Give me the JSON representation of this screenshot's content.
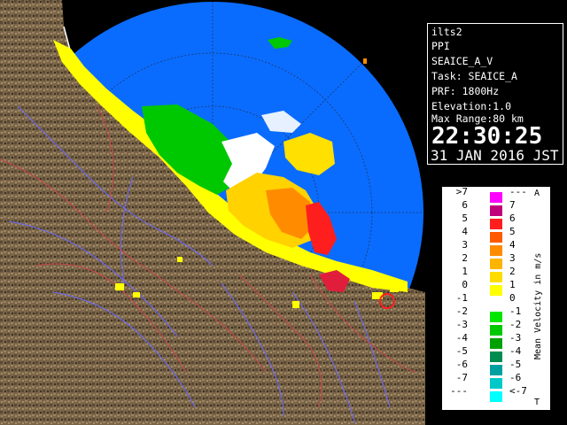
{
  "info": {
    "site": "ilts2",
    "scan": "PPI",
    "product": "SEAICE_A_V",
    "task": "Task: SEAICE_A",
    "prf": "PRF: 1800Hz",
    "elevation": "Elevation:1.0",
    "max_range": "Max Range:80 km",
    "time": "22:30:25",
    "date": "31 JAN 2016 JST"
  },
  "legend": {
    "title": "Mean Velocity in m/s",
    "top_marker": "A",
    "bottom_marker": "T",
    "rows": [
      {
        "left": ">7",
        "right": "---",
        "color": "#ff00ff"
      },
      {
        "left": "6",
        "right": "7",
        "color": "#c0007a"
      },
      {
        "left": "5",
        "right": "6",
        "color": "#ff1e1e"
      },
      {
        "left": "4",
        "right": "5",
        "color": "#ff5a00"
      },
      {
        "left": "3",
        "right": "4",
        "color": "#ff8c00"
      },
      {
        "left": "2",
        "right": "3",
        "color": "#ffb400"
      },
      {
        "left": "1",
        "right": "2",
        "color": "#ffdc00"
      },
      {
        "left": "0",
        "right": "1",
        "color": "#ffff00"
      },
      {
        "left": "-1",
        "right": "0",
        "color": "#ffffff"
      },
      {
        "left": "-2",
        "right": "-1",
        "color": "#00e600"
      },
      {
        "left": "-3",
        "right": "-2",
        "color": "#00c800"
      },
      {
        "left": "-4",
        "right": "-3",
        "color": "#00a000"
      },
      {
        "left": "-5",
        "right": "-4",
        "color": "#008c50"
      },
      {
        "left": "-6",
        "right": "-5",
        "color": "#00a0a0"
      },
      {
        "left": "-7",
        "right": "-6",
        "color": "#00c8c8"
      },
      {
        "left": "---",
        "right": "<-7",
        "color": "#00ffff"
      }
    ]
  },
  "colors": {
    "radar_fill": "#0a6cff",
    "land": "#7a6548",
    "land_shadow": "#3b3024",
    "rivers": "#6a6aff",
    "boundaries": "#c84848",
    "coast": "#ffffff",
    "range_rings": "#223355"
  }
}
